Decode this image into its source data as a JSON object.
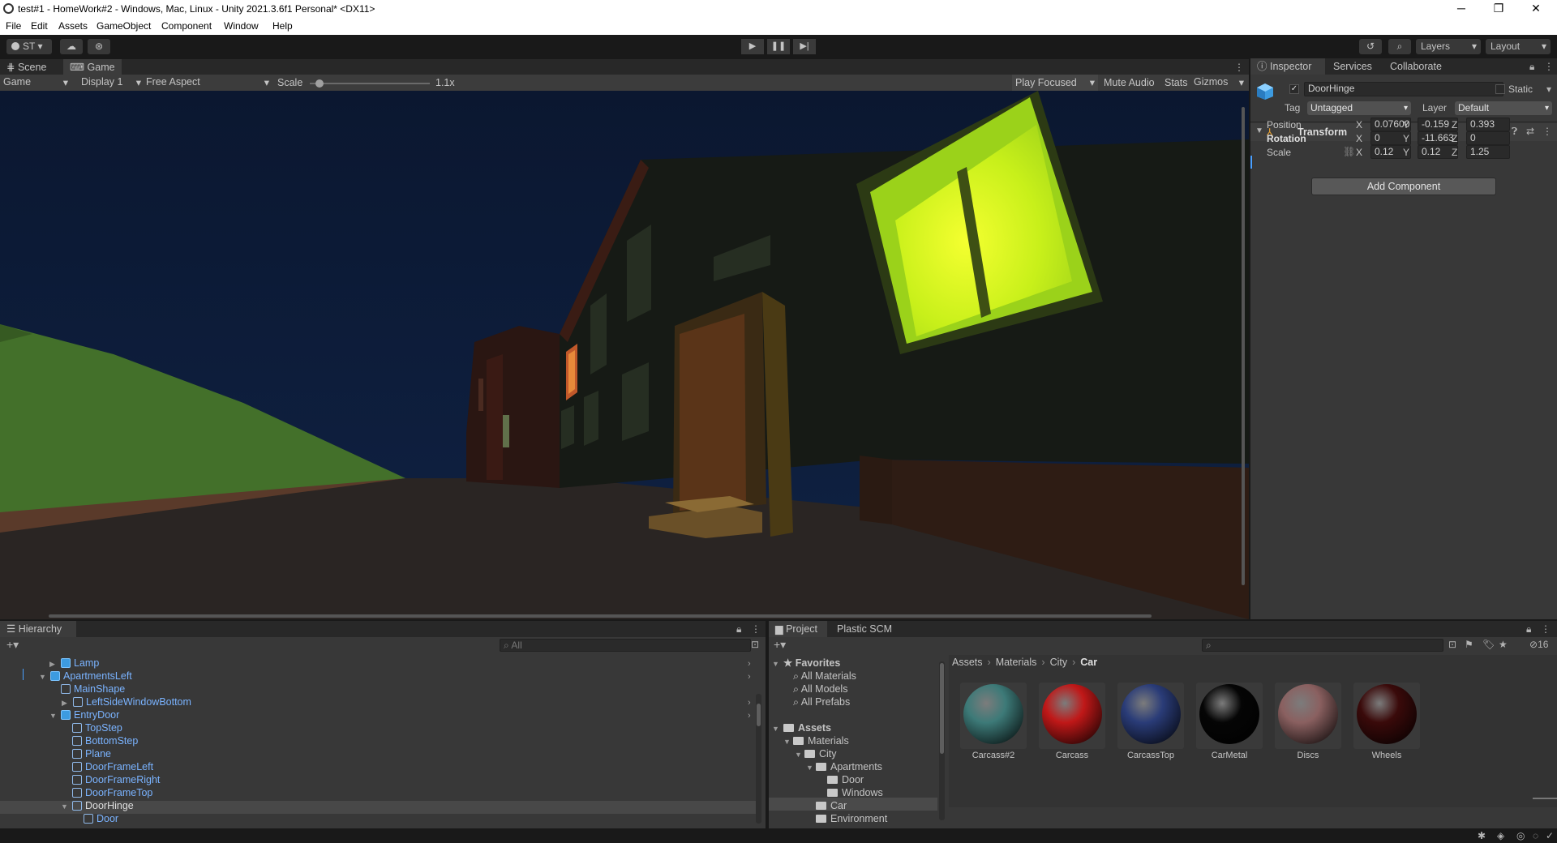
{
  "window": {
    "title": "test#1 - HomeWork#2 - Windows, Mac, Linux - Unity 2021.3.6f1 Personal* <DX11>",
    "controls": [
      "─",
      "❐",
      "✕"
    ]
  },
  "menu": [
    "File",
    "Edit",
    "Assets",
    "GameObject",
    "Component",
    "Window",
    "Help"
  ],
  "toolbar": {
    "account": "ST",
    "layers": "Layers",
    "layout": "Layout"
  },
  "scene_tabs": [
    "Scene",
    "Game"
  ],
  "game_bar": {
    "mode": "Game",
    "display": "Display 1",
    "aspect": "Free Aspect",
    "scale_label": "Scale",
    "scale_value": "1.1x",
    "scale_level": 0.05,
    "play_focused": "Play Focused",
    "mute": "Mute Audio",
    "stats": "Stats",
    "gizmos": "Gizmos"
  },
  "hierarchy": {
    "tab": "Hierarchy",
    "search_placeholder": "All",
    "items": [
      "Lamp",
      "ApartmentsLeft",
      "MainShape",
      "LeftSideWindowBottom",
      "EntryDoor",
      "TopStep",
      "BottomStep",
      "Plane",
      "DoorFrameLeft",
      "DoorFrameRight",
      "DoorFrameTop",
      "DoorHinge",
      "Door"
    ]
  },
  "project": {
    "tabs": [
      "Project",
      "Plastic SCM"
    ],
    "favorites": "Favorites",
    "fav_items": [
      "All Materials",
      "All Models",
      "All Prefabs"
    ],
    "assets": "Assets",
    "tree": [
      "Materials",
      "City",
      "Apartments",
      "Door",
      "Windows",
      "Car",
      "Environment"
    ],
    "breadcrumb": [
      "Assets",
      "Materials",
      "City",
      "Car"
    ],
    "hidden_count": "16",
    "materials": [
      {
        "name": "Carcass#2",
        "color": "#3d7a78"
      },
      {
        "name": "Carcass",
        "color": "#c01818"
      },
      {
        "name": "CarcassTop",
        "color": "#2a3c78"
      },
      {
        "name": "CarMetal",
        "color": "#050505"
      },
      {
        "name": "Discs",
        "color": "#8a6060"
      },
      {
        "name": "Wheels",
        "color": "#3a0a0a"
      }
    ]
  },
  "inspector": {
    "tabs": [
      "Inspector",
      "Services",
      "Collaborate"
    ],
    "object_name": "DoorHinge",
    "static": "Static",
    "tag_label": "Tag",
    "tag": "Untagged",
    "layer_label": "Layer",
    "layer": "Default",
    "component": "Transform",
    "rows": [
      {
        "label": "Position",
        "x": "0.076006",
        "y": "-0.159",
        "z": "0.393"
      },
      {
        "label": "Rotation",
        "x": "0",
        "y": "-11.663",
        "z": "0"
      },
      {
        "label": "Scale",
        "x": "0.12",
        "y": "0.12",
        "z": "1.25"
      }
    ],
    "axes": [
      "X",
      "Y",
      "Z"
    ],
    "add_component": "Add Component"
  }
}
